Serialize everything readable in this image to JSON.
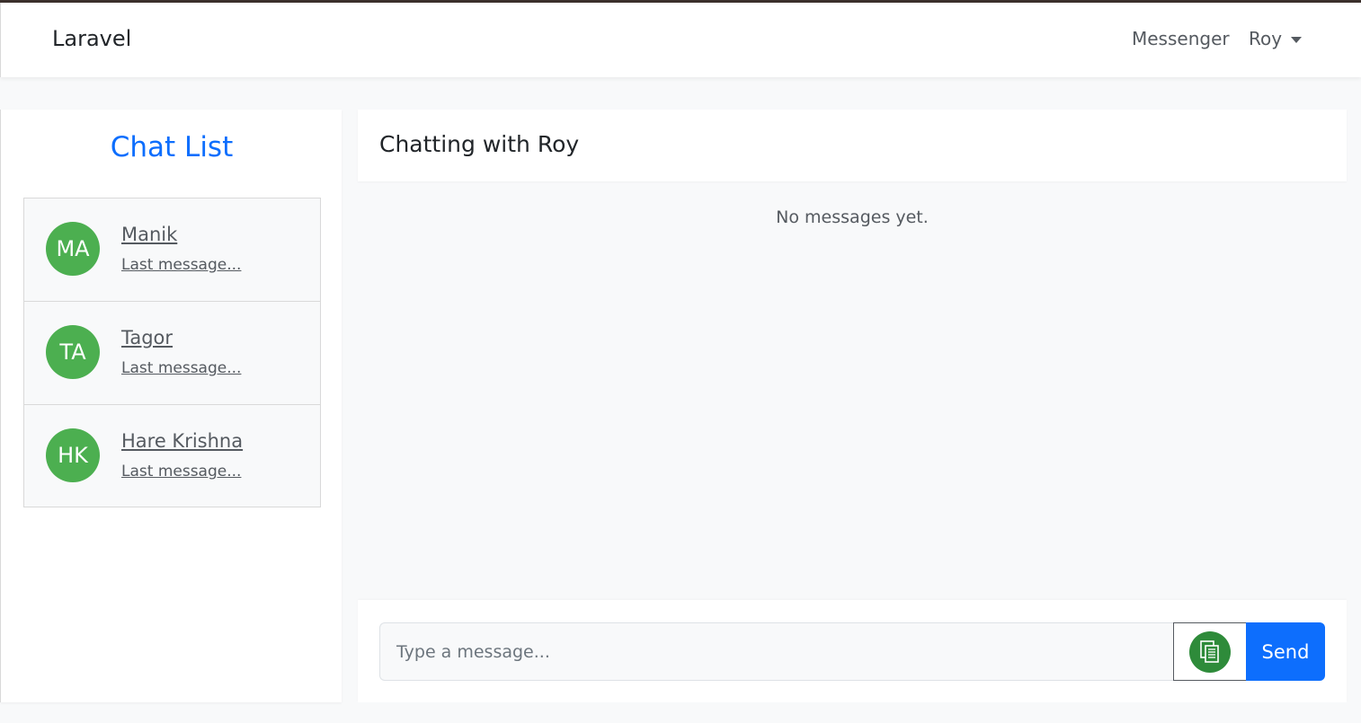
{
  "navbar": {
    "brand": "Laravel",
    "links": {
      "messenger": "Messenger",
      "user": "Roy"
    }
  },
  "sidebar": {
    "title": "Chat List",
    "contacts": [
      {
        "initials": "MA",
        "name": "Manik",
        "last_message": "Last message..."
      },
      {
        "initials": "TA",
        "name": "Tagor",
        "last_message": "Last message..."
      },
      {
        "initials": "HK",
        "name": "Hare Krishna",
        "last_message": "Last message..."
      }
    ]
  },
  "chat": {
    "header_title": "Chatting with Roy",
    "empty_text": "No messages yet.",
    "input_placeholder": "Type a message...",
    "attach_icon": "document-copy-icon",
    "send_label": "Send"
  },
  "colors": {
    "accent": "#0d6efd",
    "avatar": "#4caf50",
    "attach": "#2e8b3a"
  }
}
